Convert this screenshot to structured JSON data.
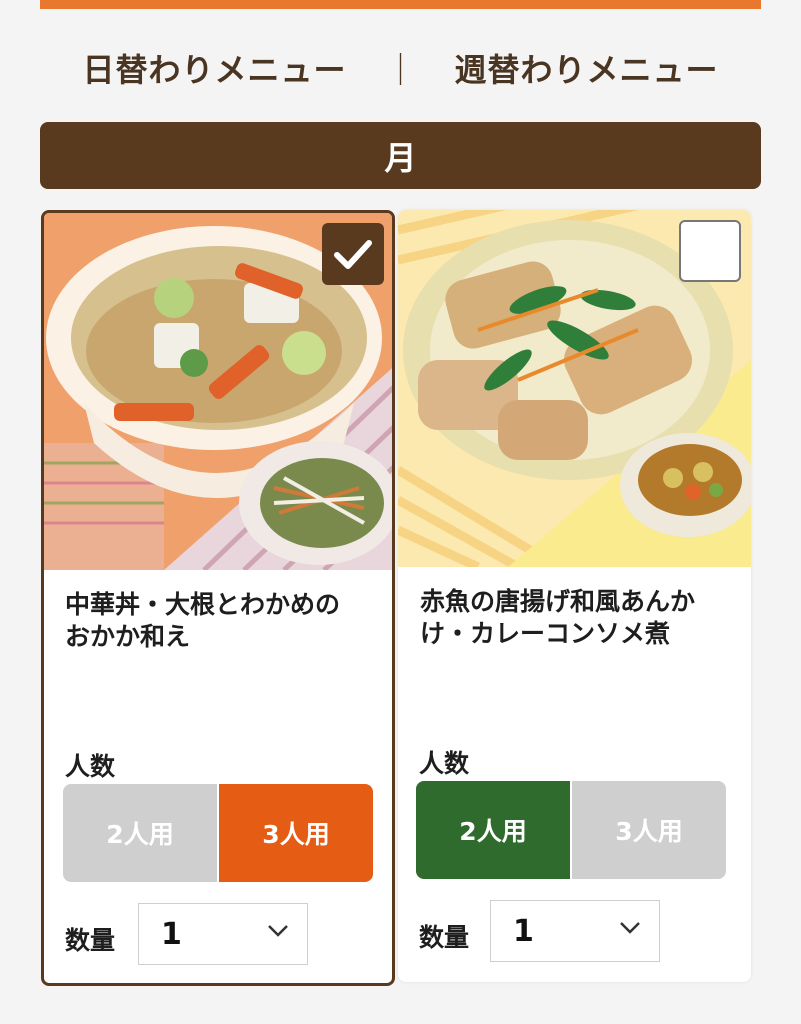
{
  "tabs": {
    "daily": "日替わりメニュー",
    "separator": "｜",
    "weekly": "週替わりメニュー"
  },
  "day": "月",
  "colors": {
    "accent_orange": "#e9782f",
    "brown": "#5a3a1e",
    "selected_orange": "#e55c14",
    "selected_green": "#2e6b2d",
    "inactive_gray": "#cfcfcf"
  },
  "cards": [
    {
      "selected": true,
      "title_line1": "中華丼・大根とわかめの",
      "title_line2": "おかか和え",
      "people_label": "人数",
      "options": [
        "2人用",
        "3人用"
      ],
      "selected_option": "3人用",
      "qty_label": "数量",
      "qty_value": "1",
      "check_icon": "checkmark-icon"
    },
    {
      "selected": false,
      "title_line1": "赤魚の唐揚げ和風あんか",
      "title_line2": "け・カレーコンソメ煮",
      "people_label": "人数",
      "options": [
        "2人用",
        "3人用"
      ],
      "selected_option": "2人用",
      "qty_label": "数量",
      "qty_value": "1",
      "check_icon": "empty-checkbox-icon"
    }
  ]
}
